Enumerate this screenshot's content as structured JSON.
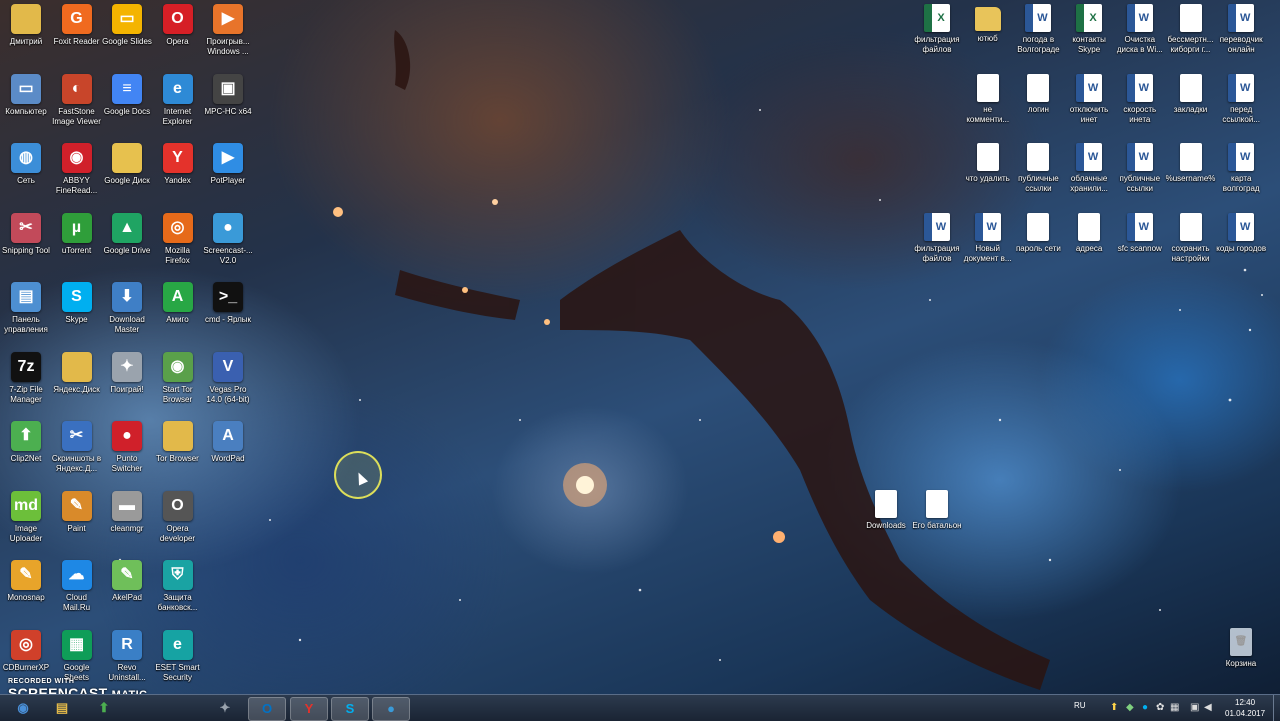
{
  "desktop": {
    "left_icons": [
      {
        "label": "Дмитрий",
        "icon": "user-folder-icon",
        "color": "#e2b94a"
      },
      {
        "label": "Foxit Reader",
        "icon": "foxit-reader-icon",
        "color": "#f06a1f"
      },
      {
        "label": "Google Slides",
        "icon": "google-slides-icon",
        "color": "#f4b400"
      },
      {
        "label": "Opera",
        "icon": "opera-icon",
        "color": "#d61f26"
      },
      {
        "label": "Проигрыв... Windows ...",
        "icon": "media-player-icon",
        "color": "#e8742a"
      },
      {
        "label": "Компьютер",
        "icon": "computer-icon",
        "color": "#5b8bc7"
      },
      {
        "label": "FastStone Image Viewer",
        "icon": "faststone-icon",
        "color": "#c8452a"
      },
      {
        "label": "Google Docs",
        "icon": "google-docs-icon",
        "color": "#4285f4"
      },
      {
        "label": "Internet Explorer",
        "icon": "ie-icon",
        "color": "#2e8ad6"
      },
      {
        "label": "MPC-HC x64",
        "icon": "mpc-icon",
        "color": "#444444"
      },
      {
        "label": "Сеть",
        "icon": "network-icon",
        "color": "#3c8ed8"
      },
      {
        "label": "ABBYY FineRead...",
        "icon": "abbyy-icon",
        "color": "#d0202a"
      },
      {
        "label": "Google Диск",
        "icon": "google-drive-folder-icon",
        "color": "#e7c14e"
      },
      {
        "label": "Yandex",
        "icon": "yandex-browser-icon",
        "color": "#e4322b"
      },
      {
        "label": "PotPlayer",
        "icon": "potplayer-icon",
        "color": "#2f8de4"
      },
      {
        "label": "Snipping Tool",
        "icon": "snipping-tool-icon",
        "color": "#c24a5a"
      },
      {
        "label": "uTorrent",
        "icon": "utorrent-icon",
        "color": "#2f9e3a"
      },
      {
        "label": "Google Drive",
        "icon": "google-drive-icon",
        "color": "#1fa463"
      },
      {
        "label": "Mozilla Firefox",
        "icon": "firefox-icon",
        "color": "#e66a1a"
      },
      {
        "label": "Screencast-... V2.0",
        "icon": "screencast-icon",
        "color": "#3a9ad8"
      },
      {
        "label": "Панель управления",
        "icon": "control-panel-icon",
        "color": "#4d8fd1"
      },
      {
        "label": "Skype",
        "icon": "skype-icon",
        "color": "#00aff0"
      },
      {
        "label": "Download Master",
        "icon": "download-master-icon",
        "color": "#3f7fc6"
      },
      {
        "label": "Амиго",
        "icon": "amigo-icon",
        "color": "#28a745"
      },
      {
        "label": "cmd - Ярлык",
        "icon": "cmd-icon",
        "color": "#111111"
      },
      {
        "label": "7-Zip File Manager",
        "icon": "7zip-icon",
        "color": "#111111"
      },
      {
        "label": "Яндекс.Диск",
        "icon": "yandex-disk-icon",
        "color": "#e2b94a"
      },
      {
        "label": "Поиграй!",
        "icon": "gamepad-icon",
        "color": "#9aa3ad"
      },
      {
        "label": "Start Tor Browser",
        "icon": "tor-icon",
        "color": "#5aa04a"
      },
      {
        "label": "Vegas Pro 14.0 (64-bit)",
        "icon": "vegas-icon",
        "color": "#3a60b0"
      },
      {
        "label": "Clip2Net",
        "icon": "clip2net-icon",
        "color": "#4caf50"
      },
      {
        "label": "Скриншоты в Яндекс.Д...",
        "icon": "yandex-screenshot-icon",
        "color": "#3a70c0"
      },
      {
        "label": "Punto Switcher",
        "icon": "punto-switcher-icon",
        "color": "#d0202a"
      },
      {
        "label": "Tor Browser",
        "icon": "tor-folder-icon",
        "color": "#e2b94a"
      },
      {
        "label": "WordPad",
        "icon": "wordpad-icon",
        "color": "#4a7fc0"
      },
      {
        "label": "Image Uploader",
        "icon": "image-uploader-icon",
        "color": "#6cbf3a"
      },
      {
        "label": "Paint",
        "icon": "paint-icon",
        "color": "#d98a2a"
      },
      {
        "label": "cleanmgr",
        "icon": "cleanmgr-icon",
        "color": "#9a9a9a"
      },
      {
        "label": "Opera developer",
        "icon": "opera-developer-icon",
        "color": "#555555"
      },
      {
        "label": "",
        "icon": "empty",
        "color": ""
      },
      {
        "label": "Monosnap",
        "icon": "monosnap-icon",
        "color": "#e8a42a"
      },
      {
        "label": "Cloud Mail.Ru",
        "icon": "cloud-mailru-icon",
        "color": "#1e88e5"
      },
      {
        "label": "AkelPad",
        "icon": "akelpad-icon",
        "color": "#6fbf5a"
      },
      {
        "label": "Защита банковск...",
        "icon": "bank-protection-icon",
        "color": "#1aa3a3"
      },
      {
        "label": "",
        "icon": "empty",
        "color": ""
      },
      {
        "label": "CDBurnerXP",
        "icon": "cdburnerxp-icon",
        "color": "#d0402a"
      },
      {
        "label": "Google Sheets",
        "icon": "google-sheets-icon",
        "color": "#0f9d58"
      },
      {
        "label": "Revo Uninstall...",
        "icon": "revo-uninstaller-icon",
        "color": "#3a7fc6"
      },
      {
        "label": "ESET Smart Security",
        "icon": "eset-icon",
        "color": "#16a3a3"
      }
    ],
    "right_icons": [
      {
        "label": "фильтрация файлов",
        "type": "excel"
      },
      {
        "label": "ютюб",
        "type": "folder"
      },
      {
        "label": "погода в Волгограде",
        "type": "word"
      },
      {
        "label": "контакты Skype",
        "type": "excel"
      },
      {
        "label": "Очистка диска в Wi...",
        "type": "word"
      },
      {
        "label": "бессмертн... киборги г...",
        "type": "doc"
      },
      {
        "label": "переводчик онлайн",
        "type": "word"
      },
      {
        "label": "не комменти...",
        "type": "doc"
      },
      {
        "label": "логин",
        "type": "doc"
      },
      {
        "label": "отключить инет",
        "type": "word"
      },
      {
        "label": "скорость инета",
        "type": "word"
      },
      {
        "label": "закладки",
        "type": "doc"
      },
      {
        "label": "перед ссылкой...",
        "type": "word"
      },
      {
        "label": "что удалить",
        "type": "doc"
      },
      {
        "label": "публичные ссылки",
        "type": "doc"
      },
      {
        "label": "облачные хранили...",
        "type": "word"
      },
      {
        "label": "публичные ссылки",
        "type": "word"
      },
      {
        "label": "%username%",
        "type": "doc"
      },
      {
        "label": "карта волгоград",
        "type": "word"
      },
      {
        "label": "фильтрация файлов",
        "type": "word"
      },
      {
        "label": "Новый документ в...",
        "type": "word"
      },
      {
        "label": "пароль сети",
        "type": "doc"
      },
      {
        "label": "адреса",
        "type": "doc"
      },
      {
        "label": "sfc scannow",
        "type": "word"
      },
      {
        "label": "сохранить настройки",
        "type": "doc"
      },
      {
        "label": "коды городов",
        "type": "word"
      },
      {
        "label": "Downloads",
        "type": "doc"
      },
      {
        "label": "Его батальон",
        "type": "doc"
      },
      {
        "label": "Корзина",
        "type": "recycle"
      }
    ]
  },
  "watermark": {
    "line1": "RECORDED WITH",
    "line2": "SCREENCAST",
    "line3": "MATIC"
  },
  "taskbar": {
    "buttons": [
      {
        "icon": "start-orb-icon",
        "glyph": "◉",
        "color": "#4a90d9"
      },
      {
        "icon": "explorer-icon",
        "glyph": "▤",
        "color": "#e2b94a"
      },
      {
        "icon": "clip2net-icon",
        "glyph": "⬆",
        "color": "#4caf50"
      },
      {
        "icon": "gamepad-icon",
        "glyph": "✦",
        "color": "#9aa3ad"
      },
      {
        "icon": "outlook-icon",
        "glyph": "O",
        "color": "#0072c6"
      },
      {
        "icon": "yandex-browser-icon",
        "glyph": "Y",
        "color": "#e4322b"
      },
      {
        "icon": "skype-icon",
        "glyph": "S",
        "color": "#00aff0"
      },
      {
        "icon": "screencast-icon",
        "glyph": "●",
        "color": "#3a9ad8"
      }
    ],
    "language": "RU",
    "time": "12:40",
    "date": "01.04.2017"
  }
}
